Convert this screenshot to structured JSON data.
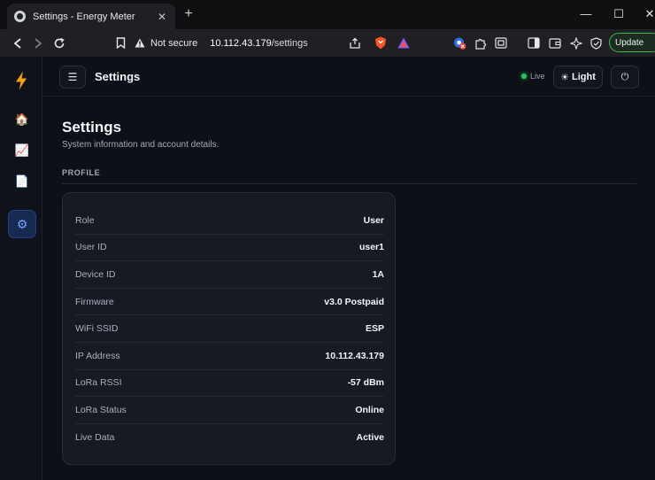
{
  "browser": {
    "tab_title": "Settings - Energy Meter",
    "tab_close": "✕",
    "new_tab": "+",
    "window_controls": {
      "minimize": "—",
      "maximize": "☐",
      "close": "✕"
    },
    "not_secure_label": "Not secure",
    "url_host": "10.112.43.179",
    "url_path": "/settings",
    "update_label": "Update",
    "accent_update": "#3fb950"
  },
  "sidebar": {
    "logo_icon": "lightning-bolt-icon",
    "items": [
      {
        "name": "home",
        "icon": "home-icon",
        "glyph": "🏠",
        "active": false
      },
      {
        "name": "charts",
        "icon": "chart-icon",
        "glyph": "📈",
        "active": false
      },
      {
        "name": "reports",
        "icon": "document-icon",
        "glyph": "📄",
        "active": false
      },
      {
        "name": "settings",
        "icon": "gear-icon",
        "glyph": "⚙",
        "active": true
      }
    ],
    "active_color": "#162a52"
  },
  "topbar": {
    "menu_glyph": "☰",
    "title": "Settings",
    "live_label": "Live",
    "live_color": "#22c55e",
    "theme_glyph": "☀",
    "theme_label": "Light",
    "power_glyph": "⏻"
  },
  "page": {
    "title": "Settings",
    "subtitle": "System information and account details.",
    "section_label": "PROFILE"
  },
  "profile": {
    "rows": [
      {
        "label": "Role",
        "value": "User"
      },
      {
        "label": "User ID",
        "value": "user1"
      },
      {
        "label": "Device ID",
        "value": "1A"
      },
      {
        "label": "Firmware",
        "value": "v3.0 Postpaid"
      },
      {
        "label": "WiFi SSID",
        "value": "ESP"
      },
      {
        "label": "IP Address",
        "value": "10.112.43.179"
      },
      {
        "label": "LoRa RSSI",
        "value": "-57 dBm"
      },
      {
        "label": "LoRa Status",
        "value": "Online"
      },
      {
        "label": "Live Data",
        "value": "Active"
      }
    ]
  }
}
